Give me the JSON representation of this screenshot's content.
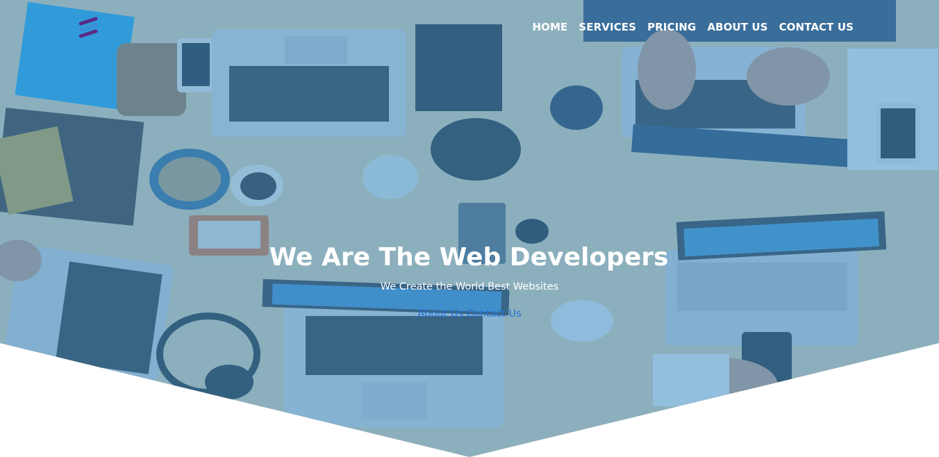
{
  "nav": {
    "items": [
      {
        "label": "HOME"
      },
      {
        "label": "SERVICES"
      },
      {
        "label": "PRICING"
      },
      {
        "label": "ABOUT US"
      },
      {
        "label": "CONTACT US"
      }
    ]
  },
  "hero": {
    "title": "We Are The Web Developers",
    "subtitle": "We Create the World Best Websites",
    "link_about": "About Us",
    "link_contact": "Contact Us"
  },
  "colors": {
    "overlay": "#4696cd",
    "link": "#1e73d8",
    "logo_purple": "#5b2a86",
    "logo_blue": "#3c8ed8"
  },
  "icons": {
    "logo": "stacked-stripes-logo-icon"
  }
}
